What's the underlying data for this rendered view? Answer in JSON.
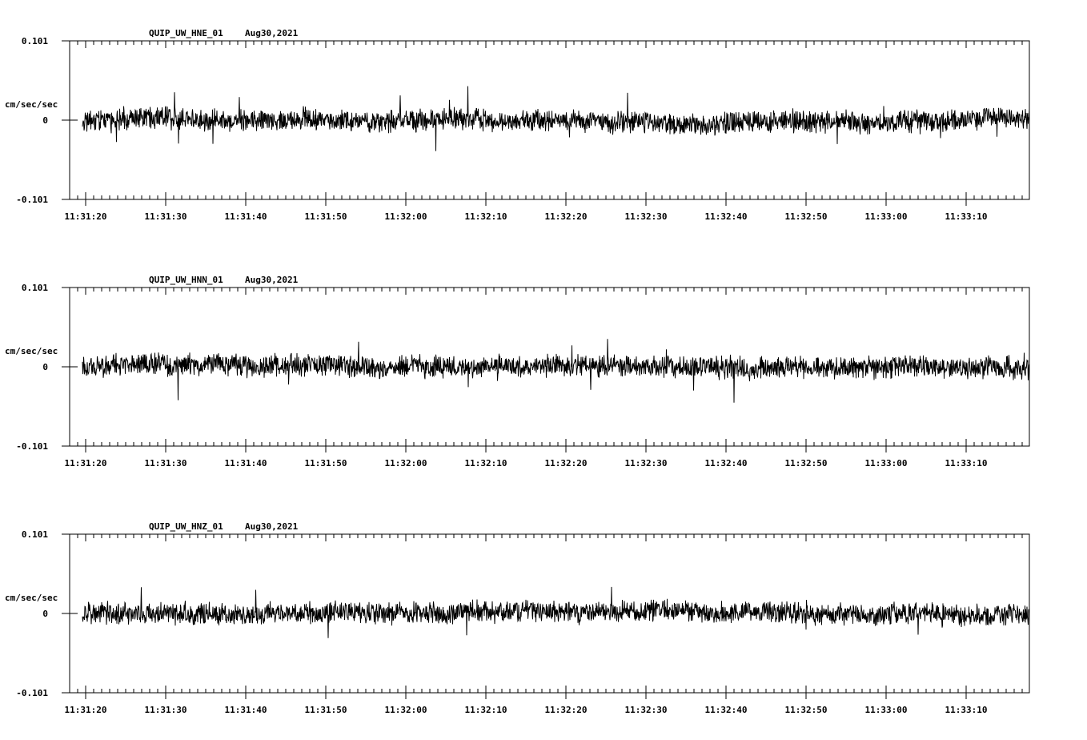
{
  "chart_data": [
    {
      "type": "line",
      "title": "QUIP_UW_HNE_01",
      "date": "Aug30,2021",
      "ylabel": "cm/sec/sec",
      "ylim": [
        -0.101,
        0.101
      ],
      "yticks": [
        "0.101",
        "0",
        "-0.101"
      ],
      "xticks": [
        "11:31:20",
        "11:31:30",
        "11:31:40",
        "11:31:50",
        "11:32:00",
        "11:32:10",
        "11:32:20",
        "11:32:30",
        "11:32:40",
        "11:32:50",
        "11:33:00",
        "11:33:10"
      ],
      "x_start": "11:31:19.8",
      "x_end": "11:33:17.8",
      "noise_amplitude": 0.012,
      "peak_amplitude": 0.036
    },
    {
      "type": "line",
      "title": "QUIP_UW_HNN_01",
      "date": "Aug30,2021",
      "ylabel": "cm/sec/sec",
      "ylim": [
        -0.101,
        0.101
      ],
      "yticks": [
        "0.101",
        "0",
        "-0.101"
      ],
      "xticks": [
        "11:31:20",
        "11:31:30",
        "11:31:40",
        "11:31:50",
        "11:32:00",
        "11:32:10",
        "11:32:20",
        "11:32:30",
        "11:32:40",
        "11:32:50",
        "11:33:00",
        "11:33:10"
      ],
      "x_start": "11:31:19.8",
      "x_end": "11:33:17.8",
      "noise_amplitude": 0.012,
      "peak_amplitude": 0.034
    },
    {
      "type": "line",
      "title": "QUIP_UW_HNZ_01",
      "date": "Aug30,2021",
      "ylabel": "cm/sec/sec",
      "ylim": [
        -0.101,
        0.101
      ],
      "yticks": [
        "0.101",
        "0",
        "-0.101"
      ],
      "xticks": [
        "11:31:20",
        "11:31:30",
        "11:31:40",
        "11:31:50",
        "11:32:00",
        "11:32:10",
        "11:32:20",
        "11:32:30",
        "11:32:40",
        "11:32:50",
        "11:33:00",
        "11:33:10"
      ],
      "x_start": "11:31:19.8",
      "x_end": "11:33:17.8",
      "noise_amplitude": 0.012,
      "peak_amplitude": 0.036
    }
  ]
}
